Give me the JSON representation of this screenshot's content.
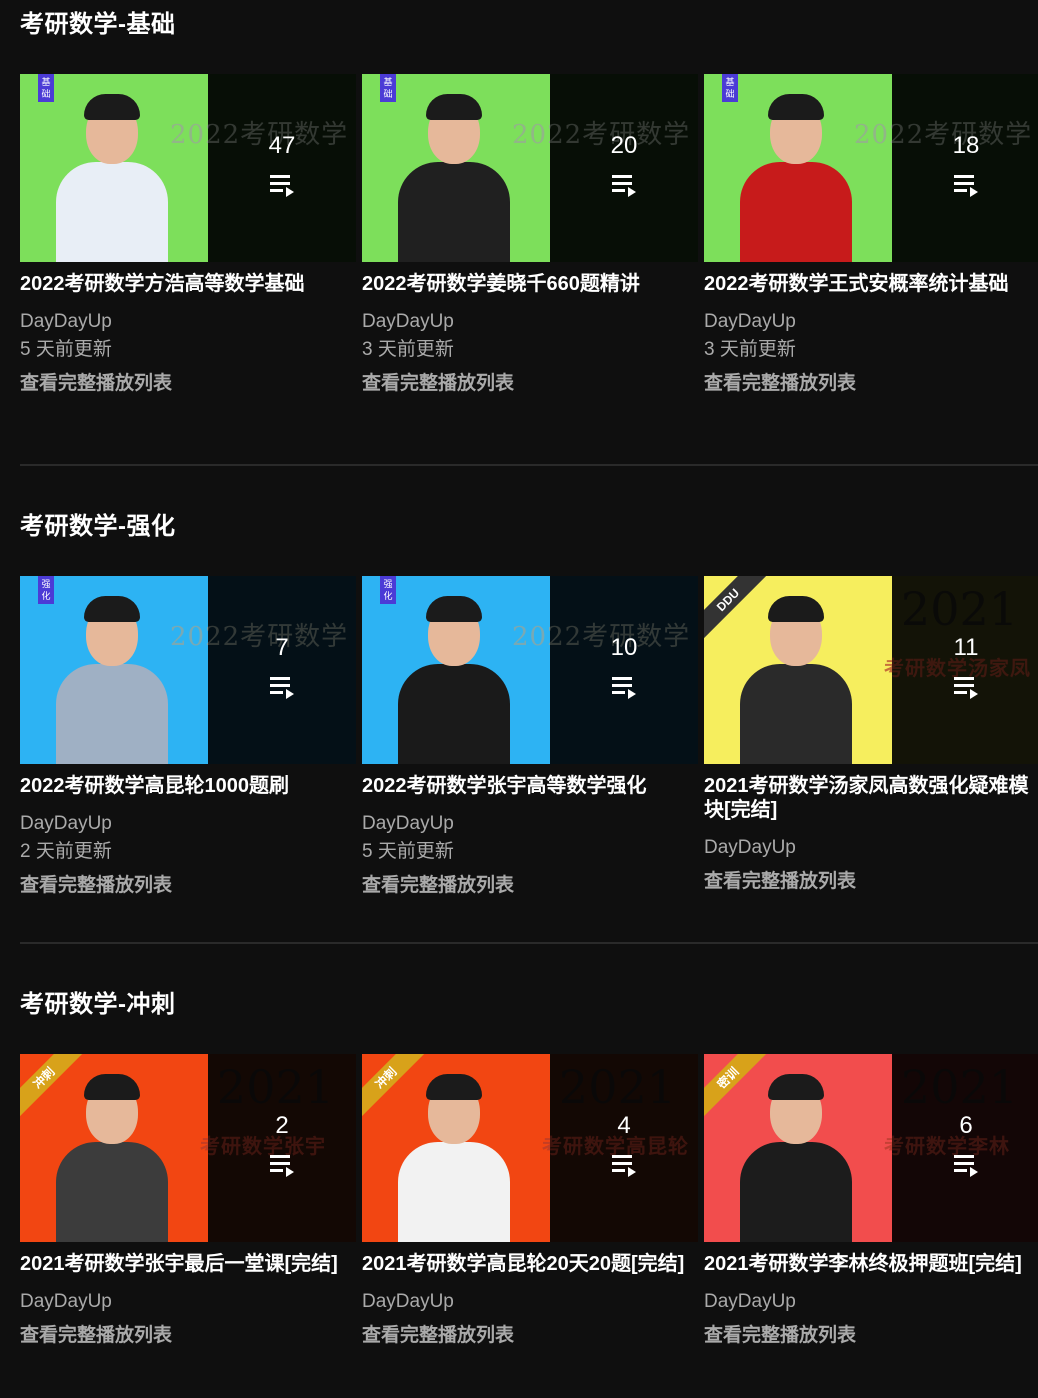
{
  "sections": [
    {
      "title": "考研数学-基础",
      "cards": [
        {
          "count": "47",
          "title": "2022考研数学方浩高等数学基础",
          "channel": "DayDayUp",
          "updated": "5 天前更新",
          "link": "查看完整播放列表",
          "badge": "基础",
          "bigtxt": "2022考研数学",
          "left_color": "#7ddf5b",
          "right_color": "#10210f",
          "shirt": "#e8eef6"
        },
        {
          "count": "20",
          "title": "2022考研数学姜晓千660题精讲",
          "channel": "DayDayUp",
          "updated": "3 天前更新",
          "link": "查看完整播放列表",
          "badge": "基础",
          "bigtxt": "2022考研数学",
          "left_color": "#7ddf5b",
          "right_color": "#10210f",
          "shirt": "#202020"
        },
        {
          "count": "18",
          "title": "2022考研数学王式安概率统计基础",
          "channel": "DayDayUp",
          "updated": "3 天前更新",
          "link": "查看完整播放列表",
          "badge": "基础",
          "bigtxt": "2022考研数学",
          "left_color": "#7ddf5b",
          "right_color": "#10210f",
          "shirt": "#c71b1b"
        }
      ]
    },
    {
      "title": "考研数学-强化",
      "cards": [
        {
          "count": "7",
          "title": "2022考研数学高昆轮1000题刷",
          "channel": "DayDayUp",
          "updated": "2 天前更新",
          "link": "查看完整播放列表",
          "badge": "强化",
          "bigtxt": "2022考研数学",
          "left_color": "#2db3f3",
          "right_color": "#0a2433",
          "shirt": "#9fb0c4"
        },
        {
          "count": "10",
          "title": "2022考研数学张宇高等数学强化",
          "channel": "DayDayUp",
          "updated": "5 天前更新",
          "link": "查看完整播放列表",
          "badge": "强化",
          "bigtxt": "2022考研数学",
          "left_color": "#2db3f3",
          "right_color": "#0a2433",
          "shirt": "#1a1a1a"
        },
        {
          "count": "11",
          "title": "2021考研数学汤家凤高数强化疑难模块[完结]",
          "channel": "DayDayUp",
          "updated": "",
          "link": "查看完整播放列表",
          "badge": "DDU",
          "bigtxt": "考研数学汤家凤",
          "left_color": "#f6ee5e",
          "right_color": "#2a2a10",
          "shirt": "#2a2a2a"
        }
      ]
    },
    {
      "title": "考研数学-冲刺",
      "cards": [
        {
          "count": "2",
          "title": "2021考研数学张宇最后一堂课[完结]",
          "channel": "DayDayUp",
          "updated": "",
          "link": "查看完整播放列表",
          "badge": "冲刺",
          "bigtxt": "考研数学张宇",
          "left_color": "#f24612",
          "right_color": "#2b120a",
          "shirt": "#3c3c3c"
        },
        {
          "count": "4",
          "title": "2021考研数学高昆轮20天20题[完结]",
          "channel": "DayDayUp",
          "updated": "",
          "link": "查看完整播放列表",
          "badge": "冲刺",
          "bigtxt": "考研数学高昆轮",
          "left_color": "#f24612",
          "right_color": "#2b120a",
          "shirt": "#f2f2f2"
        },
        {
          "count": "6",
          "title": "2021考研数学李林终极押题班[完结]",
          "channel": "DayDayUp",
          "updated": "",
          "link": "查看完整播放列表",
          "badge": "密训",
          "bigtxt": "考研数学李林",
          "left_color": "#f24d4d",
          "right_color": "#2b0f0f",
          "shirt": "#1c1c1c"
        }
      ]
    }
  ]
}
